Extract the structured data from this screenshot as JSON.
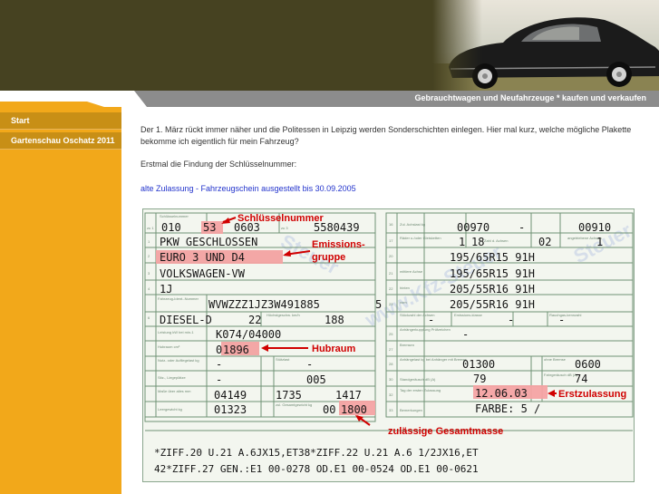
{
  "header": {
    "tagline": "Gebrauchtwagen und Neufahrzeuge * kaufen und verkaufen"
  },
  "sidebar": {
    "items": [
      {
        "label": "Start"
      },
      {
        "label": "Gartenschau Oschatz 2011"
      }
    ]
  },
  "main": {
    "intro": "Der 1. März rückt immer näher und die Politessen in Leipzig werden Sonderschichten einlegen. Hier mal kurz, welche mögliche Plakette bekomme ich eigentlich für mein Fahrzeug?",
    "step": "Erstmal die Findung der Schlüsselnummer:",
    "link": "alte Zulassung - Fahrzeugschein ausgestellt bis 30.09.2005"
  },
  "document": {
    "annotations": {
      "key_number": "Schlüsselnummer",
      "emission_group_1": "Emissions-",
      "emission_group_2": "gruppe",
      "displacement": "Hubraum",
      "first_registration": "Erstzulassung",
      "gross_weight": "zulässige Gesamtmasse"
    },
    "left": {
      "r1": [
        "010",
        "53",
        "0603",
        "5580439"
      ],
      "r2": "PKW GESCHLOSSEN",
      "r3": "EURO 3 UND D4",
      "r4": "VOLKSWAGEN-VW",
      "r5": "1J",
      "r6": [
        "WVWZZZ1JZ3W491885",
        "5"
      ],
      "r7": [
        "DIESEL-D",
        "22",
        "188"
      ],
      "r8": "K074/04000",
      "r9": [
        "0",
        "1896"
      ],
      "r10": [
        "-",
        "-"
      ],
      "r11": [
        "-",
        "005"
      ],
      "r12": [
        "04149",
        "1735",
        "1417"
      ],
      "r13": [
        "01323",
        "00",
        "1800"
      ]
    },
    "right": {
      "r1": [
        "00970",
        "-",
        "00910"
      ],
      "r2": [
        "1",
        "18",
        "02",
        "1"
      ],
      "r3": "195/65R15 91H",
      "r4": "195/65R15 91H",
      "r5": "205/55R16 91H",
      "r6": "205/55R16 91H",
      "r7": [
        "-",
        "-",
        "-"
      ],
      "r8": "-",
      "r9": [
        "01300",
        "0600"
      ],
      "r10": [
        "79",
        "74"
      ],
      "r11": "12.06.03",
      "r12": "FARBE: 5 /"
    },
    "bottom": [
      "*ZIFF.20 U.21 A.6JX15,ET38*ZIFF.22 U.21 A.6 1/2JX16,ET",
      "42*ZIFF.27 GEN.:E1 00-0278 OD.E1 00-0524 OD.E1 00-0621"
    ],
    "labels": {
      "key_header": "Schlüsselnummer",
      "n1": "zu 1",
      "n2": "zu 2",
      "n3": "zu 3",
      "r16": "16",
      "r17": "17",
      "r20": "20",
      "r21": "21",
      "r22": "22",
      "r23": "23",
      "r25": "25",
      "r26": "26",
      "r27": "27",
      "r28": "28",
      "r29": "29",
      "r30": "30",
      "r31": "31",
      "r32": "32",
      "r33": "33",
      "l1": "1",
      "l2": "2",
      "l3": "3",
      "l4": "4",
      "l5": "5",
      "l6": "6",
      "l7": "7",
      "l8": "8",
      "l9": "9",
      "l10": "10",
      "l11": "11",
      "l12": "12",
      "l13": "13",
      "l14": "14",
      "l15": "15",
      "pruef": "Prüfziffer",
      "ident": "Fahrzeug-Ident.-Nummer",
      "kw": "Höchstgeschw. km/h",
      "hubraum": "Hubraum cm³",
      "nutz": "Nutz- oder Aufliegelast kg",
      "sitz": "Sitz-, Liegeplätze",
      "mass": "Maße über alles mm",
      "leer": "Leergewicht kg",
      "zul": "zul. Gesamtgewicht kg",
      "zahl": "Zahl d. Achsen",
      "angetr": "angetriebene Achsen",
      "ges": "Gesamt-gewicht",
      "stand": "Standgeräusch dB (A)",
      "fahr": "Fahrgeräusch dB (A)",
      "tag": "Tag der ersten Zulassung",
      "bem": "Bemerkungen",
      "anh": "Anhängelast kg bei Anhänger mit Bremse",
      "anh2": "ohne Bremse",
      "zulas": "Zul. Achslast kg",
      "rad": "Räder u./oder Gleisketten",
      "bereif": "Bereifung",
      "stuck": "Stückzahl der Achsen",
      "unm": "Leistung kW bei min-1",
      "stuetz": "Stützlast",
      "mittlere": "mittlere Achse",
      "hinten": "hinten",
      "vorn": "vorn",
      "kupp": "Anhängerkupplung Prüfzeichen",
      "emiss": "Emissions-klasse",
      "art": "Art des Aufbaus",
      "hersteller": "Hersteller",
      "typ": "Typ und Ausführung",
      "kraft": "Kraftstoff",
      "hoch": "Höchstgeschw.",
      "brems": "Bremsen",
      "rauch": "Rauchgas-kennzahl",
      "ob": "obere",
      "fahrzeug": "Fahrzeugart",
      "kz": "km/h",
      "bis": "bis",
      "kg": "kg",
      "m": "m",
      "l": "l",
      "ab": "ab",
      "ob2": "ob",
      "ab2": "ab"
    },
    "watermarks": [
      "Steuer",
      "www.Kfz-Steuer",
      "Steuer"
    ]
  }
}
